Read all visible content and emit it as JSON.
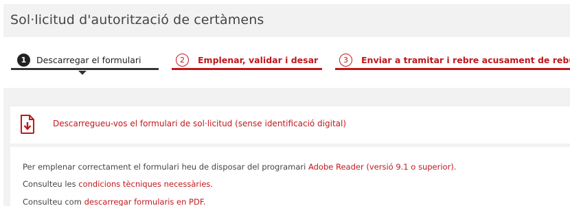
{
  "header": {
    "title": "Sol·licitud d'autorització de certàmens"
  },
  "steps": [
    {
      "number": "1",
      "label": "Descarregar el formulari",
      "state": "active"
    },
    {
      "number": "2",
      "label": "Emplenar, validar i desar",
      "state": "pending"
    },
    {
      "number": "3",
      "label": "Enviar a tramitar i rebre acusament de rebuda",
      "state": "pending"
    }
  ],
  "download": {
    "icon": "pdf-download-icon",
    "link_text": "Descarregueu-vos el formulari de sol·licitud (sense identificació digital)"
  },
  "info": {
    "line1_text": "Per emplenar correctament el formulari heu de disposar del programari ",
    "line1_link": "Adobe Reader (versió 9.1 o superior).",
    "line2_text": "Consulteu les ",
    "line2_link": "condicions tècniques necessàries.",
    "line3_text": "Consulteu com ",
    "line3_link": "descarregar formularis en PDF."
  },
  "colors": {
    "accent": "#c0171c",
    "active_step": "#333333",
    "panel_background": "#f2f2f2"
  }
}
